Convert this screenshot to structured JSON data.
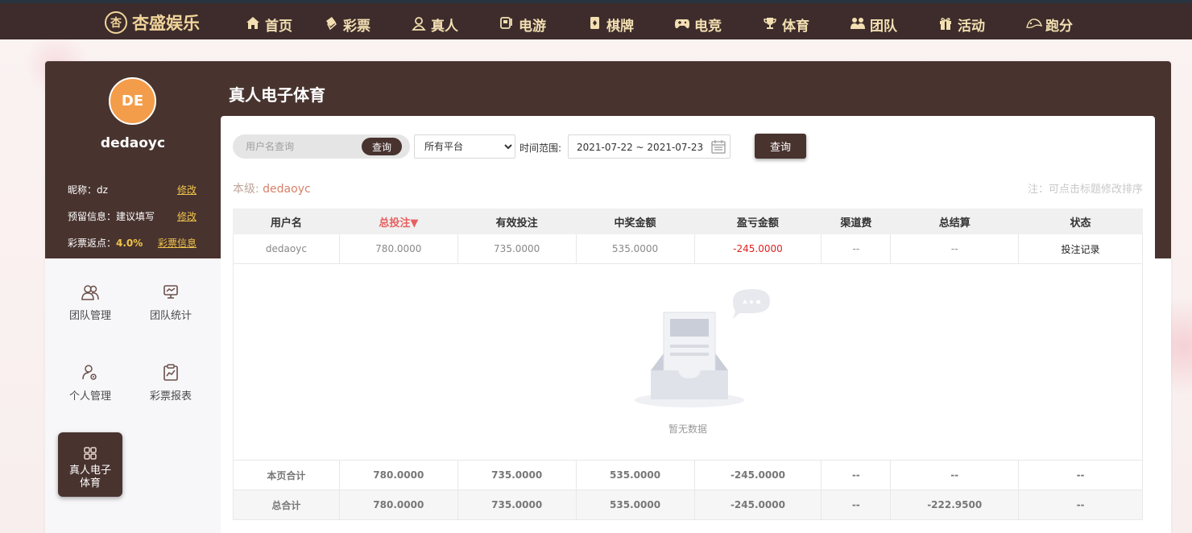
{
  "brand": {
    "name": "杏盛娱乐",
    "mark": "杏"
  },
  "nav": [
    {
      "label": "首页",
      "icon": "home-icon"
    },
    {
      "label": "彩票",
      "icon": "lottery-ticket-icon"
    },
    {
      "label": "真人",
      "icon": "live-dealer-icon"
    },
    {
      "label": "电游",
      "icon": "slot-machine-icon"
    },
    {
      "label": "棋牌",
      "icon": "card-game-icon"
    },
    {
      "label": "电竞",
      "icon": "gamepad-icon"
    },
    {
      "label": "体育",
      "icon": "trophy-icon"
    },
    {
      "label": "团队",
      "icon": "team-icon"
    },
    {
      "label": "活动",
      "icon": "gift-icon"
    },
    {
      "label": "跑分",
      "icon": "running-icon"
    }
  ],
  "user": {
    "avatar_text": "DE",
    "username": "dedaoyc",
    "nickname_label": "昵称：dz",
    "nickname_edit": "修改",
    "reserved_label": "预留信息：建议填写",
    "reserved_edit": "修改",
    "rebate_prefix": "彩票返点：",
    "rebate_value": "4.0%",
    "rebate_link": "彩票信息"
  },
  "side_menu": [
    {
      "label": "团队管理",
      "icon": "users-icon"
    },
    {
      "label": "团队统计",
      "icon": "monitor-chart-icon"
    },
    {
      "label": "个人管理",
      "icon": "user-settings-icon"
    },
    {
      "label": "彩票报表",
      "icon": "clipboard-chart-icon"
    },
    {
      "label": "真人电子体育",
      "icon": "grid-icon",
      "active": true
    }
  ],
  "page": {
    "title": "真人电子体育",
    "search_placeholder": "用户名查询",
    "search_btn": "查询",
    "platform_selected": "所有平台",
    "range_label": "时间范围:",
    "date_range": "2021-07-22 ~ 2021-07-23",
    "query_btn": "查询",
    "level_label": "本级:",
    "level_name": "dedaoyc",
    "note": "注：可点击标题修改排序"
  },
  "table": {
    "headers": [
      "用户名",
      "总投注▼",
      "有效投注",
      "中奖金额",
      "盈亏金额",
      "渠道费",
      "总结算",
      "状态"
    ],
    "row": [
      "dedaoyc",
      "780.0000",
      "735.0000",
      "535.0000",
      "-245.0000",
      "--",
      "--",
      "投注记录"
    ],
    "empty_text": "暂无数据",
    "page_total": [
      "本页合计",
      "780.0000",
      "735.0000",
      "535.0000",
      "-245.0000",
      "--",
      "--",
      "--"
    ],
    "grand_total": [
      "总合计",
      "780.0000",
      "735.0000",
      "535.0000",
      "-245.0000",
      "--",
      "-222.9500",
      "--"
    ]
  },
  "colors": {
    "topbar": "#3d2c2b",
    "brown": "#48332f",
    "gold": "#f0c44b",
    "avatar": "#f39d4b",
    "loss": "#e02020"
  }
}
